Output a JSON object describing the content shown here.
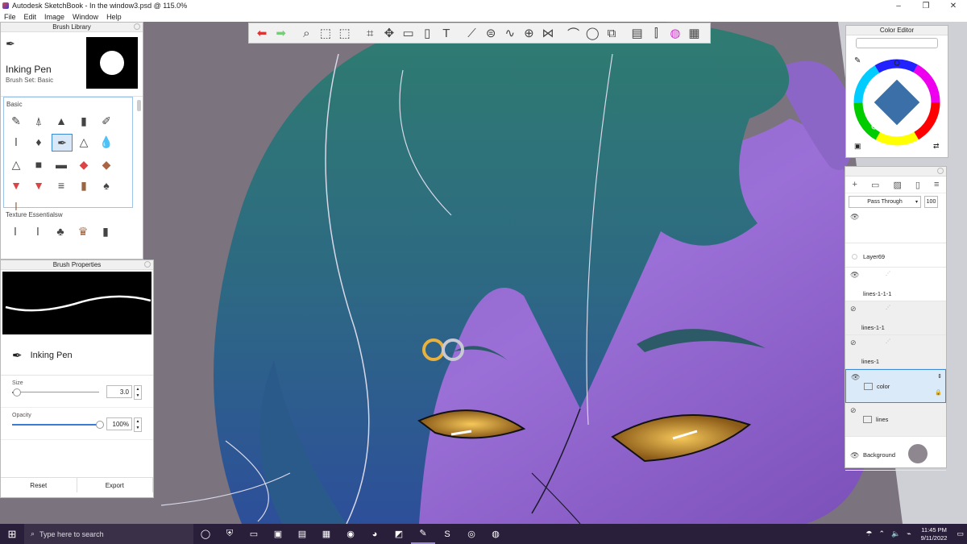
{
  "window": {
    "title": "Autodesk SketchBook - In the window3.psd @ 115.0%",
    "controls": [
      "–",
      "❐",
      "✕"
    ]
  },
  "menu": [
    "File",
    "Edit",
    "Image",
    "Window",
    "Help"
  ],
  "toolbar": {
    "tools": [
      "undo-icon",
      "redo-icon",
      "zoom-icon",
      "select-icon",
      "magic-wand-icon",
      "crop-icon",
      "transform-icon",
      "distort-icon",
      "fill-icon",
      "text-icon",
      "ruler-icon",
      "ellipse-guide-icon",
      "french-curve-icon",
      "perspective-icon",
      "symmetry-icon",
      "stroke-icon",
      "circle-icon",
      "copy-paste-icon",
      "layer-editor-icon",
      "brush-palette-icon",
      "color-wheel-icon",
      "toolbox-icon"
    ]
  },
  "brush_library": {
    "title": "Brush Library",
    "current_brush": "Inking Pen",
    "brush_set": "Brush Set: Basic",
    "section_basic": "Basic",
    "section_texture": "Texture Essentialsw"
  },
  "brush_properties": {
    "title": "Brush Properties",
    "brush_name": "Inking Pen",
    "size_label": "Size",
    "size_value": "3.0",
    "size_fraction": 0.05,
    "opacity_label": "Opacity",
    "opacity_value": "100%",
    "opacity_fraction": 1.0,
    "reset_label": "Reset",
    "export_label": "Export"
  },
  "color_editor": {
    "title": "Color Editor"
  },
  "layers": {
    "blend_mode": "Pass Through",
    "opacity": "100",
    "items": [
      {
        "name": "",
        "visible": true
      },
      {
        "name": "Layer69",
        "visible": false
      },
      {
        "name": "lines-1-1-1",
        "visible": true
      },
      {
        "name": "lines-1-1",
        "visible": false
      },
      {
        "name": "lines-1",
        "visible": false
      },
      {
        "name": "color",
        "visible": true,
        "selected": true
      },
      {
        "name": "lines",
        "visible": false
      },
      {
        "name": "Background",
        "visible": true
      }
    ]
  },
  "taskbar": {
    "search_placeholder": "Type here to search",
    "time": "11:45 PM",
    "date": "9/11/2022"
  }
}
